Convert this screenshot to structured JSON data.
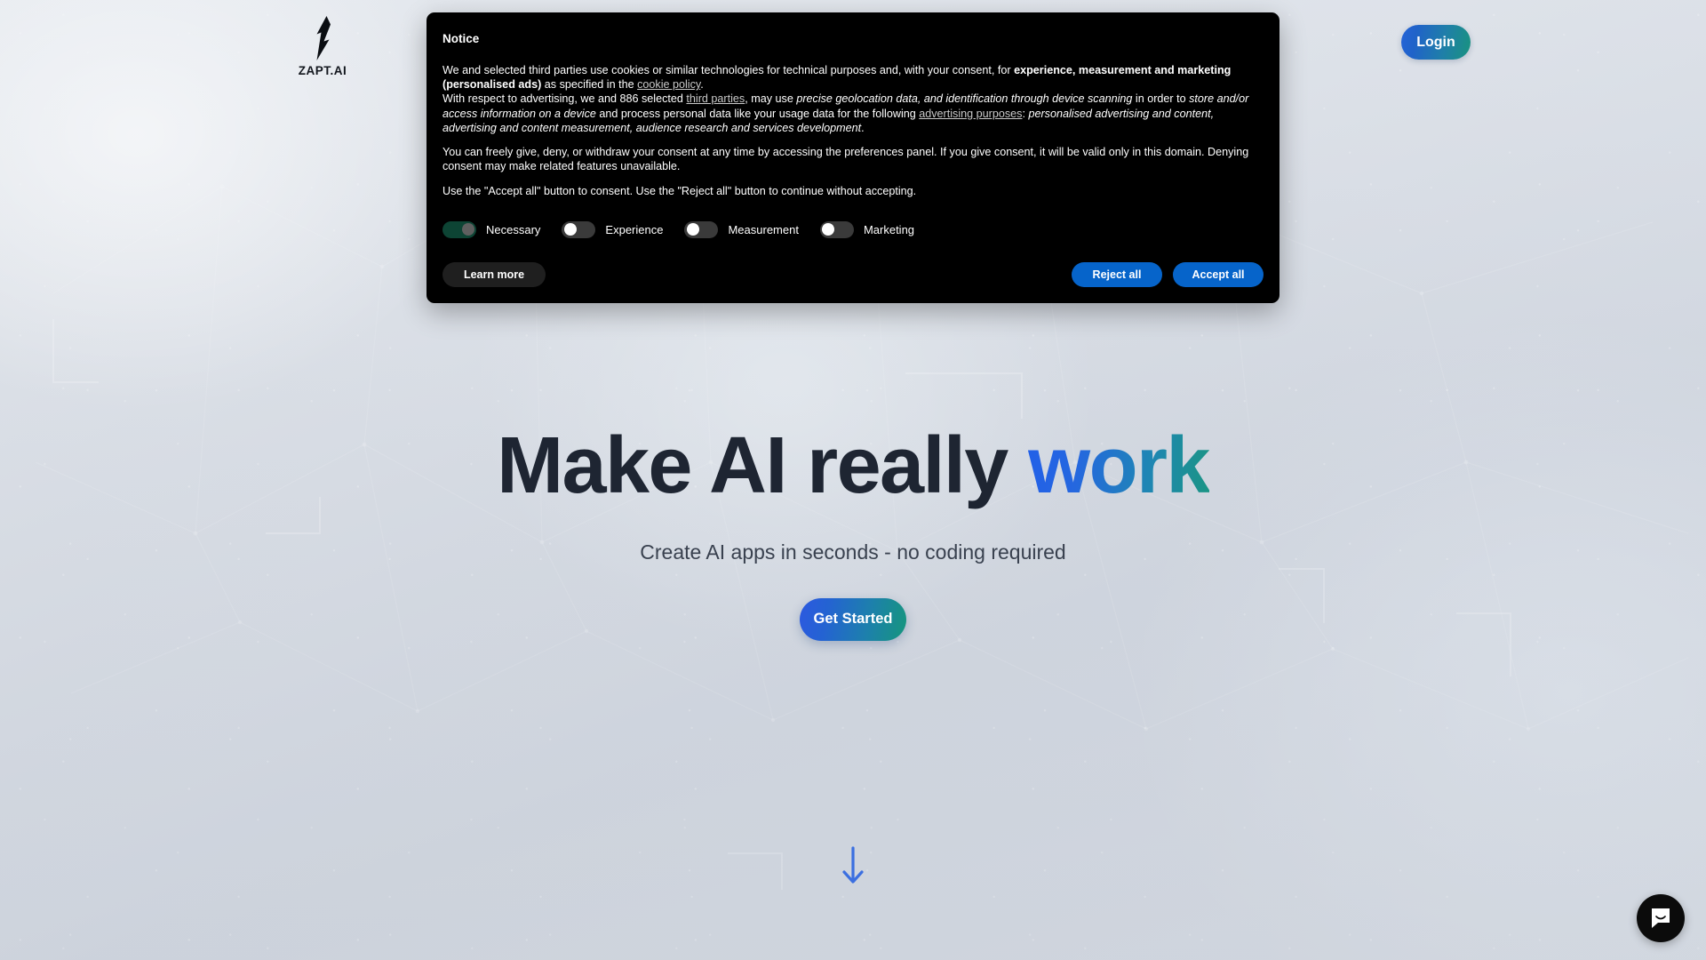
{
  "header": {
    "brand": {
      "name": "ZAPT.AI",
      "icon": "lightning-bolt-icon"
    },
    "login_label": "Login"
  },
  "hero": {
    "title_main": "Make AI really ",
    "title_accent": "work",
    "subtitle": "Create AI apps in seconds - no coding required",
    "cta_label": "Get Started",
    "scroll_icon": "arrow-down-icon"
  },
  "cookie_notice": {
    "title": "Notice",
    "paragraphs": {
      "p1_a": "We and selected third parties use cookies or similar technologies for technical purposes and, with your consent, for ",
      "p1_bold1": "experience, measurement and marketing (personalised ads)",
      "p1_b": " as specified in the ",
      "p1_link": "cookie policy",
      "p1_c": ".",
      "p2_a": "With respect to advertising, we and 886 selected ",
      "p2_link1": "third parties",
      "p2_b": ", may use ",
      "p2_ital1": "precise geolocation data, and identification through device scanning",
      "p2_c": " in order to ",
      "p2_ital2": "store and/or access information on a device",
      "p2_d": " and process personal data like your usage data for the following ",
      "p2_link2": "advertising purposes",
      "p2_e": ": ",
      "p2_ital3": "personalised advertising and content, advertising and content measurement, audience research and services development",
      "p2_f": ".",
      "p3": "You can freely give, deny, or withdraw your consent at any time by accessing the preferences panel. If you give consent, it will be valid only in this domain. Denying consent may make related features unavailable.",
      "p4": "Use the \"Accept all\" button to consent. Use the \"Reject all\" button to continue without accepting."
    },
    "toggles": [
      {
        "label": "Necessary",
        "on": true
      },
      {
        "label": "Experience",
        "on": false
      },
      {
        "label": "Measurement",
        "on": false
      },
      {
        "label": "Marketing",
        "on": false
      }
    ],
    "learn_more_label": "Learn more",
    "reject_all_label": "Reject all",
    "accept_all_label": "Accept all"
  },
  "chat_widget": {
    "icon": "chat-bubble-icon"
  },
  "colors": {
    "notice_bg": "#000000",
    "cta_blue": "#0664CA",
    "brand_gradient_start": "#2563D8",
    "brand_gradient_end": "#19937F",
    "toggle_on": "#0D4434",
    "toggle_off": "#3A3A3A",
    "arrow_blue": "#3B6FE0",
    "page_bg": "#D6DBE3"
  }
}
